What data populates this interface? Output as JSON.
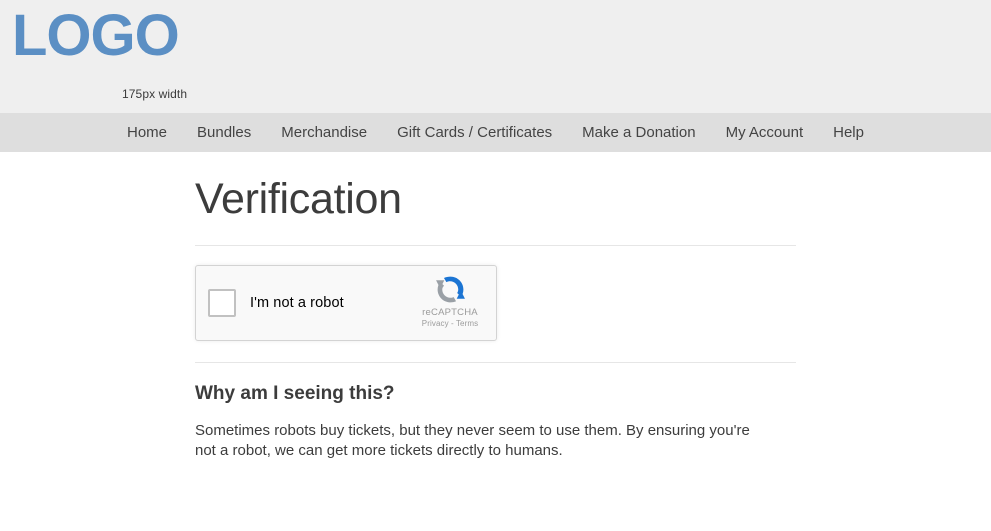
{
  "header": {
    "logo_text": "LOGO",
    "logo_caption": "175px width",
    "logo_color": "#5b8fc4",
    "background": "#efefef"
  },
  "nav": {
    "background": "#dedede",
    "items": [
      {
        "label": "Home"
      },
      {
        "label": "Bundles"
      },
      {
        "label": "Merchandise"
      },
      {
        "label": "Gift Cards / Certificates"
      },
      {
        "label": "Make a Donation"
      },
      {
        "label": "My Account"
      },
      {
        "label": "Help"
      }
    ]
  },
  "main": {
    "page_title": "Verification",
    "recaptcha": {
      "checkbox_label": "I'm not a robot",
      "brand_name": "reCAPTCHA",
      "brand_links": "Privacy - Terms",
      "logo_icon": "recaptcha-logo-icon",
      "logo_blue": "#1c75d3",
      "logo_gray": "#9aa0a6",
      "checked": false
    },
    "explanation": {
      "title": "Why am I seeing this?",
      "body": "Sometimes robots buy tickets, but they never seem to use them. By ensuring you're not a robot, we can get more tickets directly to humans."
    }
  }
}
